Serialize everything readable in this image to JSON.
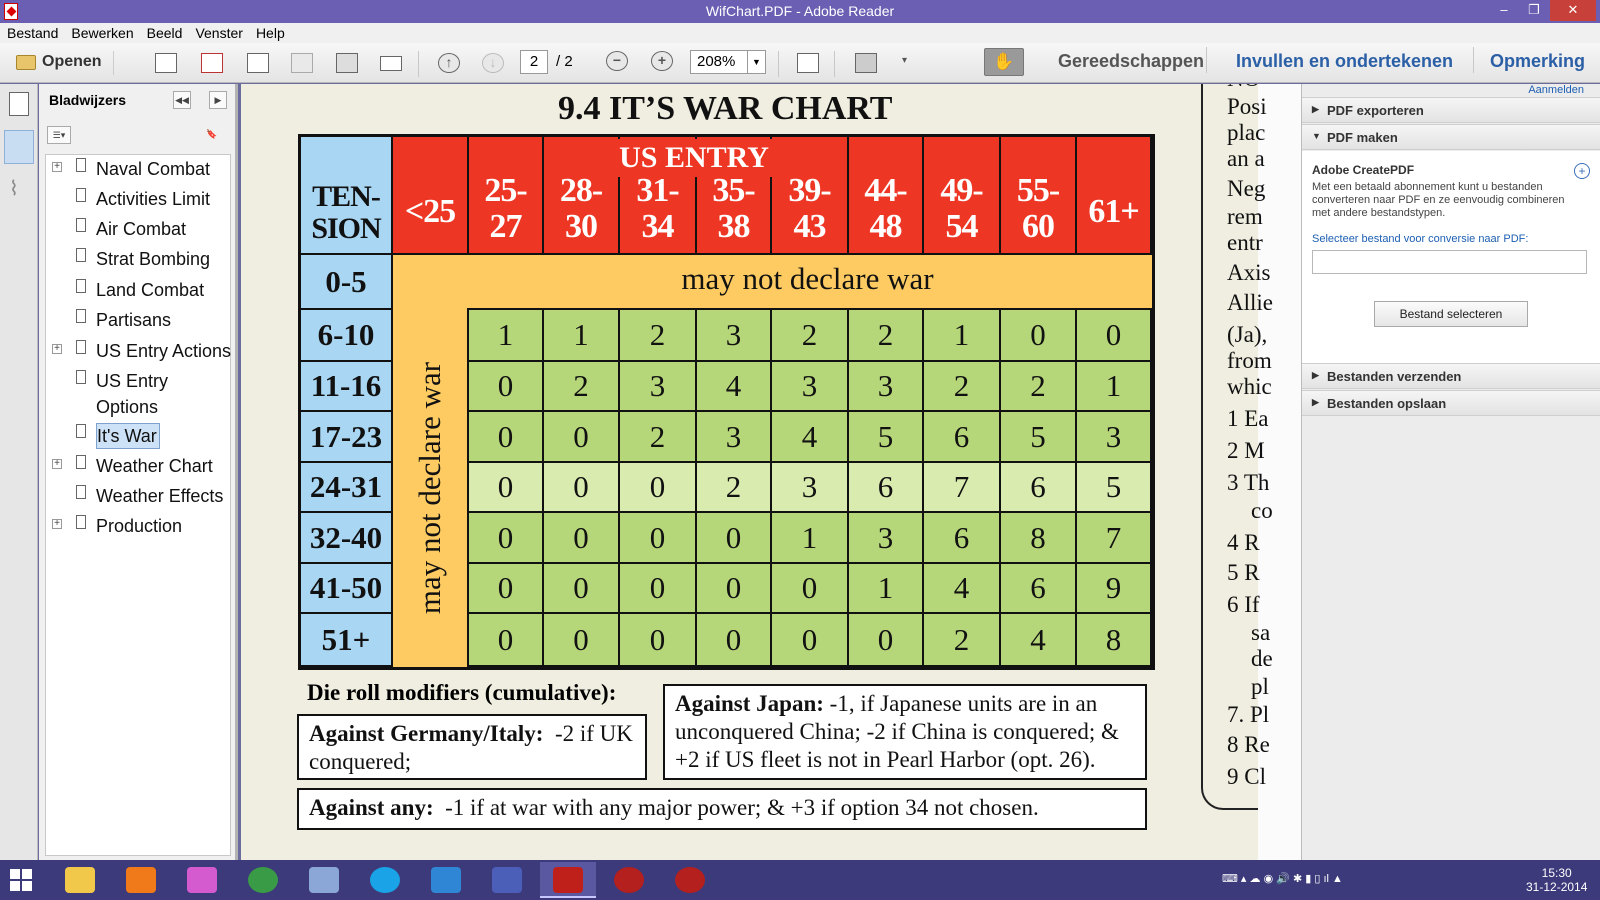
{
  "window": {
    "title": "WifChart.PDF - Adobe Reader",
    "min": "‒",
    "max": "❐",
    "close": "✕"
  },
  "menu": [
    "Bestand",
    "Bewerken",
    "Beeld",
    "Venster",
    "Help"
  ],
  "toolbar": {
    "open_label": "Openen",
    "page_current": "2",
    "page_total": "/ 2",
    "zoom": "208%",
    "tools": "Gereedschappen",
    "fill_sign": "Invullen en ondertekenen",
    "comment": "Opmerking"
  },
  "bookmarks": {
    "header": "Bladwijzers",
    "items": [
      {
        "label": "Naval Combat",
        "expandable": true
      },
      {
        "label": "Activities Limit",
        "expandable": false
      },
      {
        "label": "Air Combat",
        "expandable": false
      },
      {
        "label": "Strat Bombing",
        "expandable": false
      },
      {
        "label": "Land Combat",
        "expandable": false
      },
      {
        "label": "Partisans",
        "expandable": false
      },
      {
        "label": "US Entry Actions",
        "expandable": true
      },
      {
        "label": "US Entry",
        "label2": "Options",
        "expandable": false
      },
      {
        "label": "It's War",
        "expandable": false,
        "selected": true
      },
      {
        "label": "Weather Chart",
        "expandable": true
      },
      {
        "label": "Weather Effects",
        "expandable": false
      },
      {
        "label": "Production",
        "expandable": true
      }
    ]
  },
  "document": {
    "title": "9.4   IT’S WAR CHART",
    "chart": {
      "corner": [
        "TEN-",
        "SION"
      ],
      "us_entry": "US ENTRY",
      "columns": [
        [
          "<25"
        ],
        [
          "25-",
          "27"
        ],
        [
          "28-",
          "30"
        ],
        [
          "31-",
          "34"
        ],
        [
          "35-",
          "38"
        ],
        [
          "39-",
          "43"
        ],
        [
          "44-",
          "48"
        ],
        [
          "49-",
          "54"
        ],
        [
          "55-",
          "60"
        ],
        [
          "61+"
        ]
      ],
      "rows": [
        "0-5",
        "6-10",
        "11-16",
        "17-23",
        "24-31",
        "32-40",
        "41-50",
        "51+"
      ],
      "no_war_row": "may not declare war",
      "no_war_col": "may not declare war",
      "values": [
        [
          1,
          1,
          2,
          3,
          2,
          2,
          1,
          0,
          0
        ],
        [
          0,
          2,
          3,
          4,
          3,
          3,
          2,
          2,
          1
        ],
        [
          0,
          0,
          2,
          3,
          4,
          5,
          6,
          5,
          3
        ],
        [
          0,
          0,
          0,
          2,
          3,
          6,
          7,
          6,
          5
        ],
        [
          0,
          0,
          0,
          0,
          1,
          3,
          6,
          8,
          7
        ],
        [
          0,
          0,
          0,
          0,
          0,
          1,
          4,
          6,
          9
        ],
        [
          0,
          0,
          0,
          0,
          0,
          0,
          2,
          4,
          8
        ]
      ]
    },
    "modifiers": {
      "title": "Die roll modifiers (cumulative):",
      "germany_bold": "Against Germany/Italy:",
      "germany_text": "-2 if UK conquered;",
      "japan_bold": "Against Japan:",
      "japan_text": "-1, if Japanese units are in an unconquered China; -2 if China is conquered; & +2 if US fleet is not in Pearl Harbor (opt. 26).",
      "any_bold": "Against any:",
      "any_text": "-1 if at war with any major power; & +3 if option 34 not chosen."
    },
    "next_page_lines": [
      "NO",
      "Posi",
      "plac",
      "an a",
      "Neg",
      "rem",
      "entr",
      "Axis",
      "Allie",
      "(Ja),",
      "from",
      "whic",
      "1  Ea",
      "2  M",
      "3 Th",
      "co",
      "4  R",
      "5  R",
      "6  If",
      "sa",
      "de",
      "pl",
      "7. Pl",
      "8  Re",
      "9  Cl"
    ]
  },
  "right_pane": {
    "login": "Aanmelden",
    "sections": [
      "PDF exporteren",
      "PDF maken",
      "Bestanden verzenden",
      "Bestanden opslaan"
    ],
    "create_title": "Adobe CreatePDF",
    "create_text": "Met een betaald abonnement kunt u bestanden converteren naar PDF en ze eenvoudig combineren met andere bestandstypen.",
    "select_label": "Selecteer bestand voor conversie naar PDF:",
    "select_button": "Bestand selecteren"
  },
  "taskbar": {
    "apps": [
      "file-explorer",
      "media-player",
      "photos",
      "chrome",
      "thunderbird",
      "skype",
      "wings",
      "notepad",
      "adobe-reader",
      "wif-game",
      "wif-game-2"
    ],
    "time": "15:30",
    "date": "31-12-2014"
  },
  "colors": {
    "header_red": "#ee3624",
    "tension_blue": "#a9d6f2",
    "cell_green": "#b6d67a",
    "no_war_orange": "#fdcb62"
  }
}
